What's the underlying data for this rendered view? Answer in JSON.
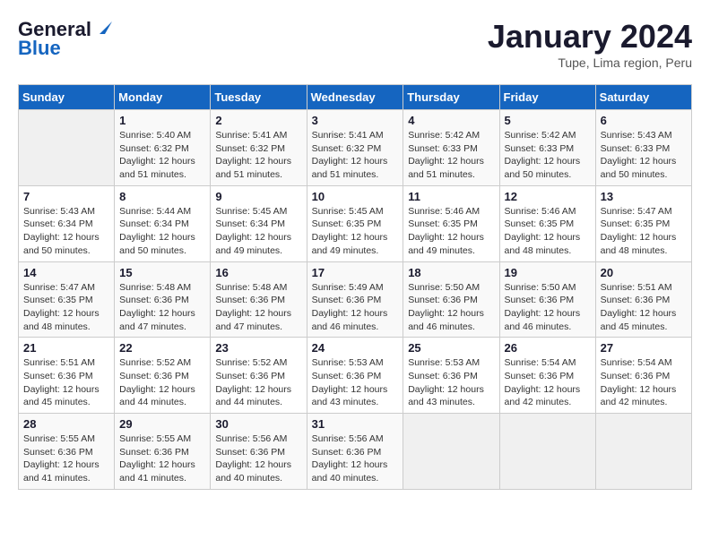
{
  "header": {
    "logo_line1": "General",
    "logo_line2": "Blue",
    "title": "January 2024",
    "subtitle": "Tupe, Lima region, Peru"
  },
  "columns": [
    "Sunday",
    "Monday",
    "Tuesday",
    "Wednesday",
    "Thursday",
    "Friday",
    "Saturday"
  ],
  "weeks": [
    [
      {
        "day": "",
        "sunrise": "",
        "sunset": "",
        "daylight": ""
      },
      {
        "day": "1",
        "sunrise": "Sunrise: 5:40 AM",
        "sunset": "Sunset: 6:32 PM",
        "daylight": "Daylight: 12 hours and 51 minutes."
      },
      {
        "day": "2",
        "sunrise": "Sunrise: 5:41 AM",
        "sunset": "Sunset: 6:32 PM",
        "daylight": "Daylight: 12 hours and 51 minutes."
      },
      {
        "day": "3",
        "sunrise": "Sunrise: 5:41 AM",
        "sunset": "Sunset: 6:32 PM",
        "daylight": "Daylight: 12 hours and 51 minutes."
      },
      {
        "day": "4",
        "sunrise": "Sunrise: 5:42 AM",
        "sunset": "Sunset: 6:33 PM",
        "daylight": "Daylight: 12 hours and 51 minutes."
      },
      {
        "day": "5",
        "sunrise": "Sunrise: 5:42 AM",
        "sunset": "Sunset: 6:33 PM",
        "daylight": "Daylight: 12 hours and 50 minutes."
      },
      {
        "day": "6",
        "sunrise": "Sunrise: 5:43 AM",
        "sunset": "Sunset: 6:33 PM",
        "daylight": "Daylight: 12 hours and 50 minutes."
      }
    ],
    [
      {
        "day": "7",
        "sunrise": "Sunrise: 5:43 AM",
        "sunset": "Sunset: 6:34 PM",
        "daylight": "Daylight: 12 hours and 50 minutes."
      },
      {
        "day": "8",
        "sunrise": "Sunrise: 5:44 AM",
        "sunset": "Sunset: 6:34 PM",
        "daylight": "Daylight: 12 hours and 50 minutes."
      },
      {
        "day": "9",
        "sunrise": "Sunrise: 5:45 AM",
        "sunset": "Sunset: 6:34 PM",
        "daylight": "Daylight: 12 hours and 49 minutes."
      },
      {
        "day": "10",
        "sunrise": "Sunrise: 5:45 AM",
        "sunset": "Sunset: 6:35 PM",
        "daylight": "Daylight: 12 hours and 49 minutes."
      },
      {
        "day": "11",
        "sunrise": "Sunrise: 5:46 AM",
        "sunset": "Sunset: 6:35 PM",
        "daylight": "Daylight: 12 hours and 49 minutes."
      },
      {
        "day": "12",
        "sunrise": "Sunrise: 5:46 AM",
        "sunset": "Sunset: 6:35 PM",
        "daylight": "Daylight: 12 hours and 48 minutes."
      },
      {
        "day": "13",
        "sunrise": "Sunrise: 5:47 AM",
        "sunset": "Sunset: 6:35 PM",
        "daylight": "Daylight: 12 hours and 48 minutes."
      }
    ],
    [
      {
        "day": "14",
        "sunrise": "Sunrise: 5:47 AM",
        "sunset": "Sunset: 6:35 PM",
        "daylight": "Daylight: 12 hours and 48 minutes."
      },
      {
        "day": "15",
        "sunrise": "Sunrise: 5:48 AM",
        "sunset": "Sunset: 6:36 PM",
        "daylight": "Daylight: 12 hours and 47 minutes."
      },
      {
        "day": "16",
        "sunrise": "Sunrise: 5:48 AM",
        "sunset": "Sunset: 6:36 PM",
        "daylight": "Daylight: 12 hours and 47 minutes."
      },
      {
        "day": "17",
        "sunrise": "Sunrise: 5:49 AM",
        "sunset": "Sunset: 6:36 PM",
        "daylight": "Daylight: 12 hours and 46 minutes."
      },
      {
        "day": "18",
        "sunrise": "Sunrise: 5:50 AM",
        "sunset": "Sunset: 6:36 PM",
        "daylight": "Daylight: 12 hours and 46 minutes."
      },
      {
        "day": "19",
        "sunrise": "Sunrise: 5:50 AM",
        "sunset": "Sunset: 6:36 PM",
        "daylight": "Daylight: 12 hours and 46 minutes."
      },
      {
        "day": "20",
        "sunrise": "Sunrise: 5:51 AM",
        "sunset": "Sunset: 6:36 PM",
        "daylight": "Daylight: 12 hours and 45 minutes."
      }
    ],
    [
      {
        "day": "21",
        "sunrise": "Sunrise: 5:51 AM",
        "sunset": "Sunset: 6:36 PM",
        "daylight": "Daylight: 12 hours and 45 minutes."
      },
      {
        "day": "22",
        "sunrise": "Sunrise: 5:52 AM",
        "sunset": "Sunset: 6:36 PM",
        "daylight": "Daylight: 12 hours and 44 minutes."
      },
      {
        "day": "23",
        "sunrise": "Sunrise: 5:52 AM",
        "sunset": "Sunset: 6:36 PM",
        "daylight": "Daylight: 12 hours and 44 minutes."
      },
      {
        "day": "24",
        "sunrise": "Sunrise: 5:53 AM",
        "sunset": "Sunset: 6:36 PM",
        "daylight": "Daylight: 12 hours and 43 minutes."
      },
      {
        "day": "25",
        "sunrise": "Sunrise: 5:53 AM",
        "sunset": "Sunset: 6:36 PM",
        "daylight": "Daylight: 12 hours and 43 minutes."
      },
      {
        "day": "26",
        "sunrise": "Sunrise: 5:54 AM",
        "sunset": "Sunset: 6:36 PM",
        "daylight": "Daylight: 12 hours and 42 minutes."
      },
      {
        "day": "27",
        "sunrise": "Sunrise: 5:54 AM",
        "sunset": "Sunset: 6:36 PM",
        "daylight": "Daylight: 12 hours and 42 minutes."
      }
    ],
    [
      {
        "day": "28",
        "sunrise": "Sunrise: 5:55 AM",
        "sunset": "Sunset: 6:36 PM",
        "daylight": "Daylight: 12 hours and 41 minutes."
      },
      {
        "day": "29",
        "sunrise": "Sunrise: 5:55 AM",
        "sunset": "Sunset: 6:36 PM",
        "daylight": "Daylight: 12 hours and 41 minutes."
      },
      {
        "day": "30",
        "sunrise": "Sunrise: 5:56 AM",
        "sunset": "Sunset: 6:36 PM",
        "daylight": "Daylight: 12 hours and 40 minutes."
      },
      {
        "day": "31",
        "sunrise": "Sunrise: 5:56 AM",
        "sunset": "Sunset: 6:36 PM",
        "daylight": "Daylight: 12 hours and 40 minutes."
      },
      {
        "day": "",
        "sunrise": "",
        "sunset": "",
        "daylight": ""
      },
      {
        "day": "",
        "sunrise": "",
        "sunset": "",
        "daylight": ""
      },
      {
        "day": "",
        "sunrise": "",
        "sunset": "",
        "daylight": ""
      }
    ]
  ]
}
